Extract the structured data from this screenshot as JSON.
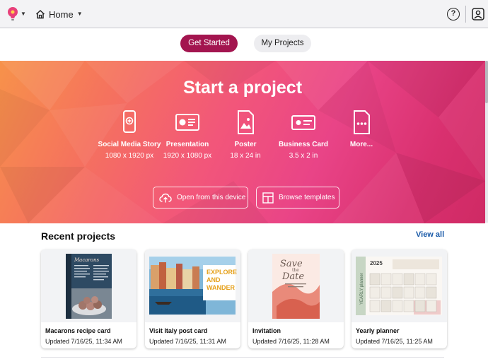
{
  "topbar": {
    "home_label": "Home",
    "help_symbol": "?",
    "icons": {
      "logo": "lightbulb-logo-icon",
      "home": "house-icon",
      "help": "question-circle-icon",
      "account": "user-account-icon"
    }
  },
  "tabs": [
    {
      "label": "Get Started",
      "active": true
    },
    {
      "label": "My Projects",
      "active": false
    }
  ],
  "hero": {
    "title": "Start a project",
    "project_types": [
      {
        "name": "Social Media Story",
        "size": "1080 x 1920 px",
        "icon": "phone-story-icon"
      },
      {
        "name": "Presentation",
        "size": "1920 x 1080 px",
        "icon": "presentation-icon"
      },
      {
        "name": "Poster",
        "size": "18 x 24 in",
        "icon": "poster-icon"
      },
      {
        "name": "Business Card",
        "size": "3.5 x 2 in",
        "icon": "business-card-icon"
      },
      {
        "name": "More...",
        "size": "",
        "icon": "more-icon"
      }
    ],
    "buttons": [
      {
        "label": "Open from this device",
        "icon": "cloud-upload-icon"
      },
      {
        "label": "Browse templates",
        "icon": "template-grid-icon"
      }
    ]
  },
  "recent": {
    "heading": "Recent projects",
    "view_all": "View all",
    "projects": [
      {
        "name": "Macarons recipe card",
        "updated": "Updated 7/16/25, 11:34 AM",
        "thumb_title": "Macarons"
      },
      {
        "name": "Visit Italy post card",
        "updated": "Updated 7/16/25, 11:31 AM",
        "thumb_text": [
          "EXPLORE",
          "AND",
          "WANDER"
        ]
      },
      {
        "name": "Invitation",
        "updated": "Updated 7/16/25, 11:28 AM",
        "thumb_text": [
          "Save",
          "the",
          "Date"
        ]
      },
      {
        "name": "Yearly planner",
        "updated": "Updated 7/16/25, 11:25 AM",
        "thumb_title": "2025",
        "thumb_side": "YEARLY planner"
      }
    ]
  },
  "colors": {
    "accent": "#a3154f",
    "link": "#1a5aa8",
    "hero_gradient": [
      "#f7924a",
      "#f2567a",
      "#cf2a64"
    ]
  }
}
